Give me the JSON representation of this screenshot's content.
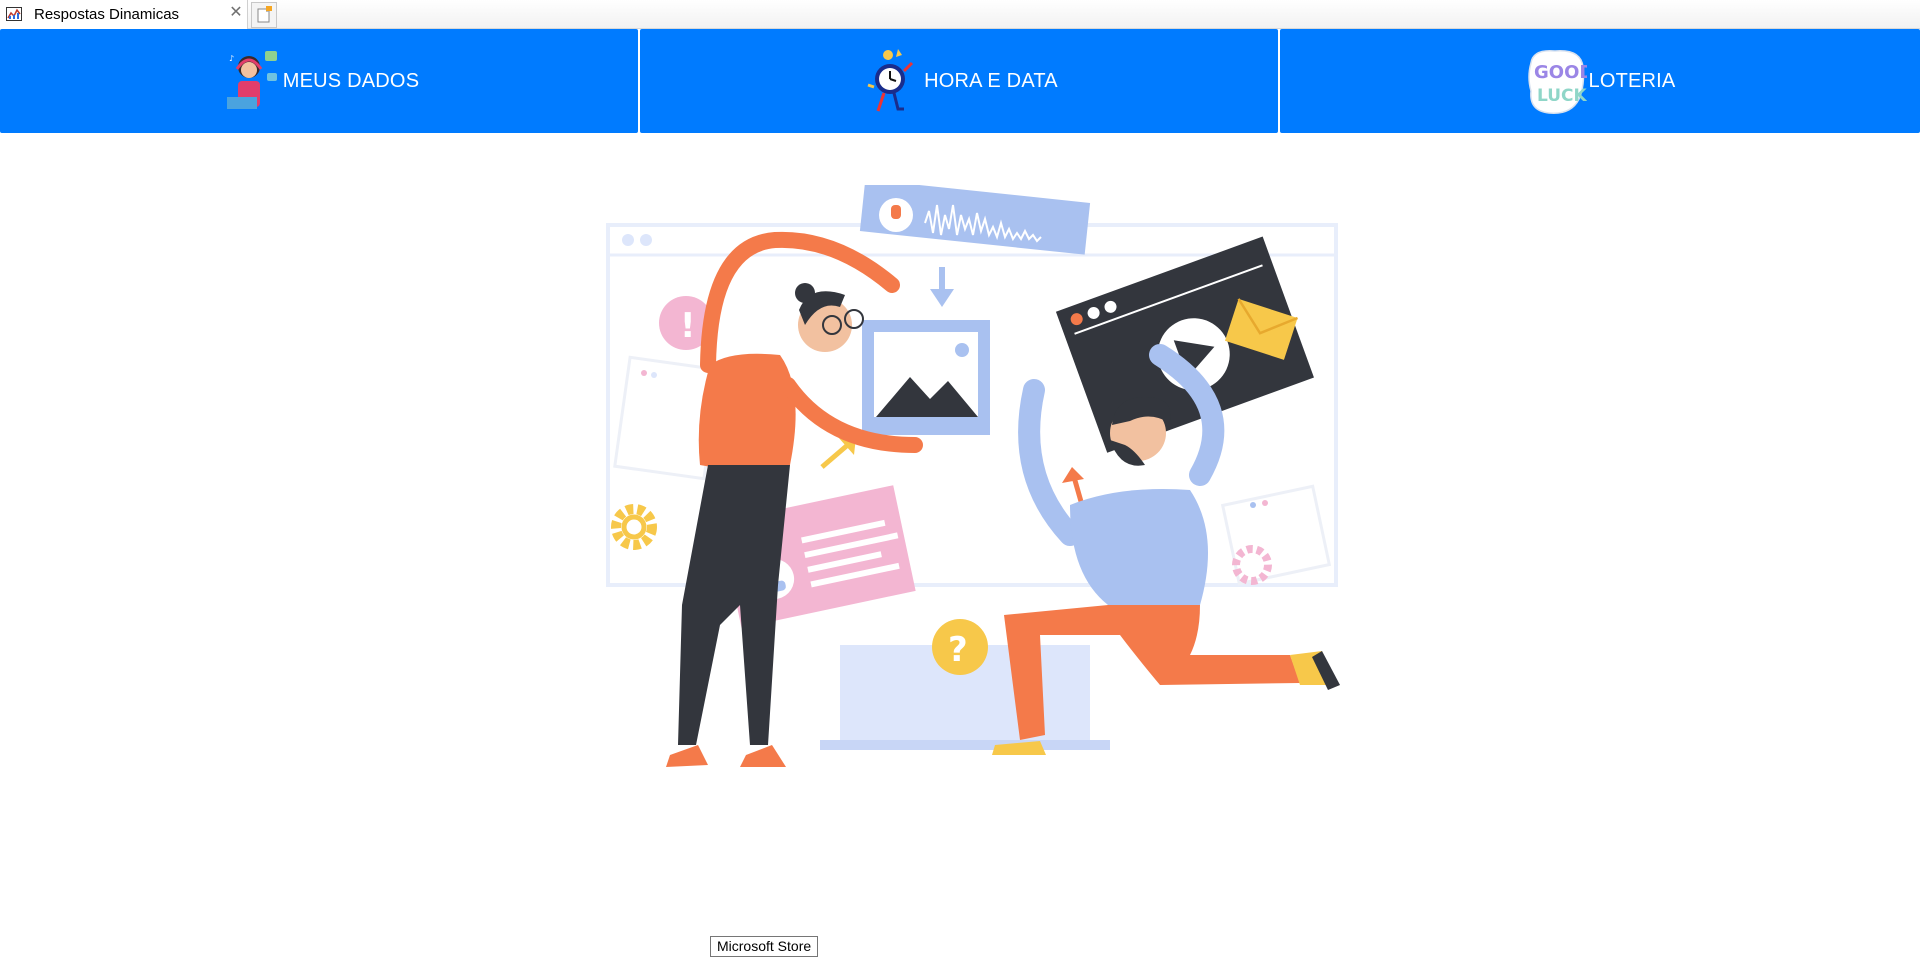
{
  "window": {
    "tab_title": "Respostas Dinamicas",
    "close_glyph": "✕"
  },
  "nav": {
    "buttons": [
      {
        "label": "MEUS DADOS",
        "icon": "person-headset-icon"
      },
      {
        "label": "HORA E DATA",
        "icon": "running-clock-icon"
      },
      {
        "label": "LOTERIA",
        "icon": "good-luck-sticker-icon",
        "sticker_line1": "GOOD",
        "sticker_line2": "LUCK"
      }
    ],
    "accent": "#007bff"
  },
  "illustration": {
    "name": "team-collaboration-illustration",
    "colors": {
      "orange": "#f47a4a",
      "dark": "#33363d",
      "blue": "#a9c1f0",
      "pink": "#f3b6d2",
      "yellow": "#f7c84a"
    }
  },
  "tooltip": {
    "text": "Microsoft Store"
  }
}
